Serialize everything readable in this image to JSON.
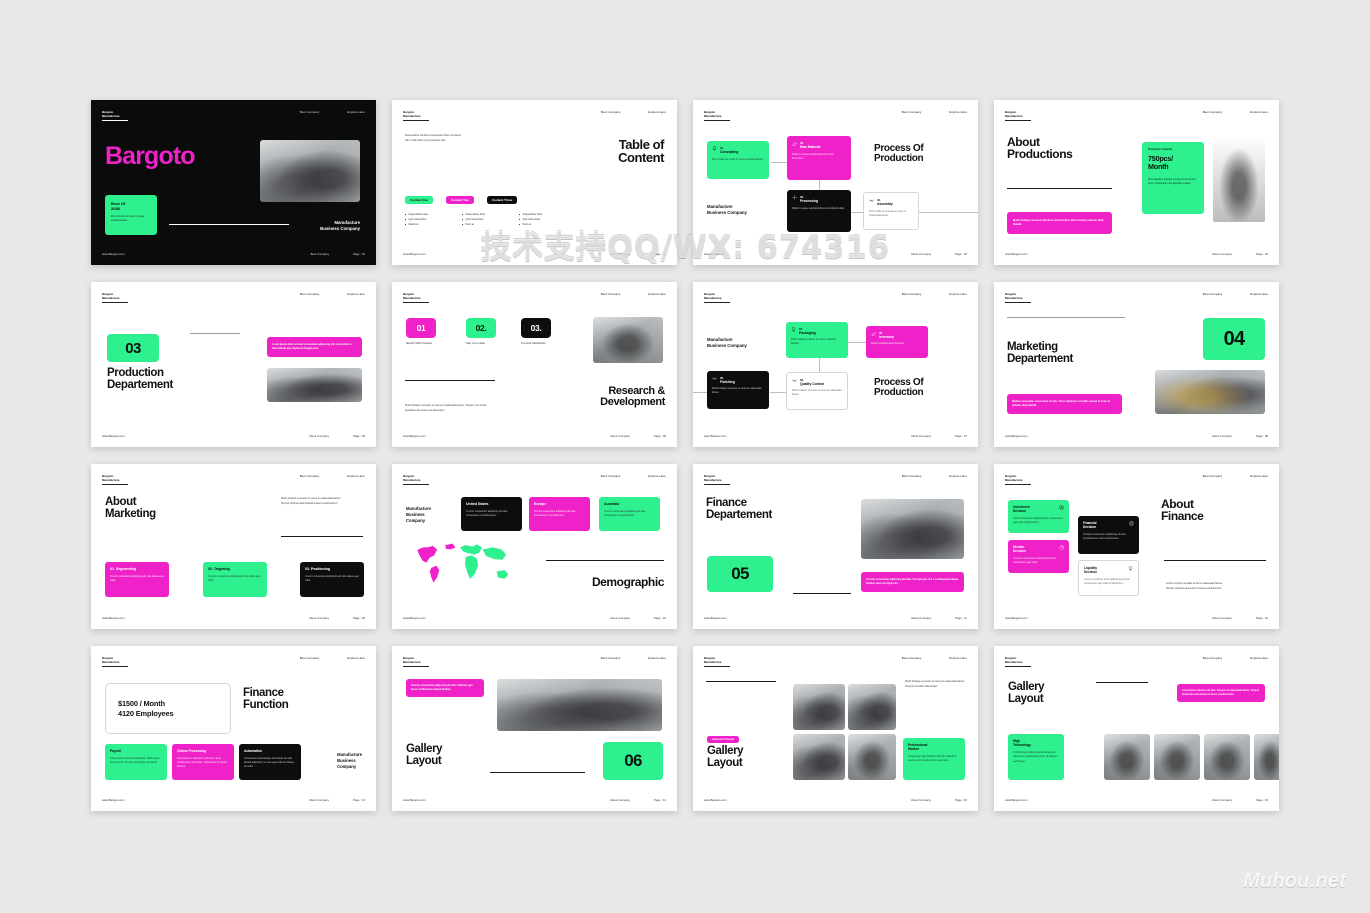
{
  "meta": {
    "watermark_center": "技术支持QQ/WX: 674316",
    "watermark_site": "Muhou.net",
    "background": "#e8e8e8",
    "accent_green": "#2ff08f",
    "accent_pink": "#ee22c8",
    "accent_black": "#0d0d0d"
  },
  "common": {
    "brand_line1": "Bargoto",
    "brand_line2": "Manufacture",
    "nav_left": "Best Company",
    "nav_right": "Explore Here",
    "footer_url": "www.Bargoto.com",
    "footer_company": "About Company",
    "footer_company_alt": "Best Company"
  },
  "slides": [
    {
      "id": "cover",
      "page": "Page : 01",
      "footer_company": "Best Company",
      "title": "Bargoto",
      "card_title": "Best Of\n2088",
      "card_body": "Proin lobortis vel metus in neque suscipit pulvinar.",
      "signature": "Manufacture\nBusiness Company"
    },
    {
      "id": "table-of-content",
      "page": "Page : 02",
      "intro": "Suspendisse tincidunt consectetur libero at mauris.\nNam mollis felis a nunc pulvinar quis.",
      "title": "Table of\nContent",
      "tabs": [
        {
          "label": "Content One",
          "color": "green"
        },
        {
          "label": "Content Two",
          "color": "pink"
        },
        {
          "label": "Content Three",
          "color": "black"
        }
      ],
      "columns": [
        [
          "Suspendisse vitae",
          "Quis consectetur",
          "Mauris at"
        ],
        [
          "Suspendisse Felis",
          "Quis consectetur",
          "Nunc at"
        ],
        [
          "Suspendisse Felis",
          "Quis consectetur",
          "Nunc at"
        ]
      ]
    },
    {
      "id": "process-production-1",
      "page": "Page : 03",
      "title": "Process Of\nProduction",
      "side_label": "Manufacture\nBusiness Company",
      "cards": [
        {
          "num": "01.",
          "name": "Concepting",
          "body": "Proin mollis vel metus in neque suscipit pulvinar.",
          "color": "green",
          "icon": "bulb-icon"
        },
        {
          "num": "02.",
          "name": "Raw Material",
          "body": "Mollis in neque suscipit pulvinar a tortor fermentum.",
          "color": "pink",
          "icon": "leaf-icon"
        },
        {
          "num": "03.",
          "name": "Processing",
          "body": "Mollis in neque suscipit pulvinar a facilisis facilisis.",
          "color": "black",
          "icon": "gear-icon"
        },
        {
          "num": "04.",
          "name": "Assembly",
          "body": "Proin mollis at senectus et netus et malesuada fames.",
          "color": "white",
          "icon": "wing-icon"
        }
      ]
    },
    {
      "id": "about-productions",
      "page": "Page : 04",
      "title": "About\nProductions",
      "pink_note": "Morbi tristique maximus faucibus et fermentum. Morbi tempor pulvinar diam blandit.",
      "green_card_kicker": "Production Capacity",
      "green_card_value": "750pcs/\nMonth",
      "green_card_body": "Proin faucibus pulvinar a metus in fermentum tortor. Consectetur nisi dignissim a diam."
    },
    {
      "id": "production-departement",
      "page": "Page : 05",
      "number": "03",
      "title": "Production\nDepartement",
      "pink_note": "Lorem ipsum dolor sit amet consectetur adipiscing elit. Consectetur a diam blandit quis dignissim feugiat justo."
    },
    {
      "id": "research-development",
      "page": "Page : 06",
      "steps": [
        {
          "num": "01",
          "label": "Identify With Prospect",
          "color": "pink"
        },
        {
          "num": "02.",
          "label": "Stay Up-to-date",
          "color": "green"
        },
        {
          "num": "03.",
          "label": "Promote Satisfaction",
          "color": "black"
        }
      ],
      "title": "Research &\nDevelopment",
      "body": "Morbi tristique senectus et netus et malesuada fames. Tempor cum sociis penatibus dis a lacus condimentum."
    },
    {
      "id": "process-production-2",
      "page": "Page : 07",
      "title": "Process Of\nProduction",
      "side_label": "Manufacture\nBusiness Company",
      "cards": [
        {
          "num": "07.",
          "name": "Packaging",
          "body": "Morbi tristique pulvinar at metus in facilisis facilisis.",
          "color": "green",
          "icon": "bulb-icon"
        },
        {
          "num": "08.",
          "name": "Inventory",
          "body": "Morbi at facilisis lacus faucibus.",
          "color": "pink",
          "icon": "leaf-icon"
        },
        {
          "num": "05.",
          "name": "Finishing",
          "body": "Morbi tristique senectus et netus et malesuada fames.",
          "color": "black",
          "icon": "wing-icon"
        },
        {
          "num": "06.",
          "name": "Quality Control",
          "body": "Morbi tristique senectus et netus et malesuada fames.",
          "color": "white",
          "icon": "wing-icon"
        }
      ]
    },
    {
      "id": "marketing-departement",
      "page": "Page : 08",
      "number": "04",
      "title": "Marketing\nDepartement",
      "pink_note": "Nullam consectetur consectetur sit duis. Tortor dignissim convallis aenean et tortor at pulvinar diam blandit."
    },
    {
      "id": "about-marketing",
      "page": "Page : 09",
      "title": "About\nMarketing",
      "intro": "Morbi tristique senectus et netus et malesuada fames.\nTempor pulvinar diam blandit a lacus condimentum.",
      "cards": [
        {
          "title": "01. Segmenting",
          "body": "Ut enim consectetur adipiscing elit duis aliqua eget nulla.",
          "color": "pink"
        },
        {
          "title": "02. Targeting",
          "body": "Ut enim consectetur adipiscing elit duis nulla eget nulla.",
          "color": "green"
        },
        {
          "title": "03. Positioning",
          "body": "Ut enim consectetur adipiscing elit duis aliqua eget nulla.",
          "color": "black"
        }
      ]
    },
    {
      "id": "demographic",
      "page": "Page : 10",
      "side_label": "Manufacture\nBusiness\nCompany",
      "title": "Demographic",
      "cards": [
        {
          "title": "United States",
          "body": "Ut enim consectetur adipiscing elit duis. Consectetur a condimentum.",
          "color": "black"
        },
        {
          "title": "Europe",
          "body": "Ut enim consectetur adipiscing elit duis. Consectetur a condimentum.",
          "color": "pink"
        },
        {
          "title": "Australia",
          "body": "Ut enim consectetur adipiscing elit duis. Consectetur a condimentum.",
          "color": "green"
        }
      ]
    },
    {
      "id": "finance-departement",
      "page": "Page : 11",
      "title": "Finance\nDepartement",
      "number": "05",
      "pink_note": "Ut enim consectetur adipiscing elit duis. Suscipit quis nisl a condimentum aliqua. Facilisis duis nisl dignissim."
    },
    {
      "id": "about-finance",
      "page": "Page : 12",
      "title": "About\nFinance",
      "body": "Lorem tempus convallis at nisl a malesuada fames.\nTempor pulvinar elementum a lacus condimentum.",
      "cards": [
        {
          "title": "Investment\nDecision",
          "body": "Tortor consectetur adipiscing duis. Consectetur eget nulla condimentum.",
          "color": "green",
          "icon": "person-icon"
        },
        {
          "title": "Dividen\nDecision",
          "body": "Ut enim a consectetur adipiscing elit duis. Consectetur eget nulla.",
          "color": "pink",
          "icon": "chart-icon"
        },
        {
          "title": "Financial\nDecision",
          "body": "Tincidunt consectetur adipiscing elit duis. Condimentum nulla condimentum.",
          "color": "black",
          "icon": "coins-icon"
        },
        {
          "title": "Liquidity\nDecision",
          "body": "Ut enim a pulvinar tortor adipiscing elit duis. Consectetur eget nulla condimentum.",
          "color": "white",
          "icon": "bulb-icon"
        }
      ]
    },
    {
      "id": "finance-function",
      "page": "Page : 13",
      "stat_line1": "$1500 / Month",
      "stat_line2": "4120 Employees",
      "title": "Finance\nFunction",
      "side_label": "Manufacture\nBusiness\nCompany",
      "cards": [
        {
          "title": "Payroll",
          "body": "Consectetur a tincidunt at facilisis. Ullamcorper at lacus duis. Ut enim sed tristique at blandit.",
          "color": "green"
        },
        {
          "title": "Claims Processing",
          "body": "Consectetur a nulla lorem pulvinar. Lacus condimentum at facilisis. Ullamcorper at mauris at lacus.",
          "color": "pink"
        },
        {
          "title": "Automation",
          "body": "Consectetur pellentesque at tincidunt at nulla blandit adipiscing. Ut eros eget nulla at tristique at mollis.",
          "color": "black"
        }
      ]
    },
    {
      "id": "gallery-layout-1",
      "page": "Page : 14",
      "pink_note": "Ut enim consectetur adipiscing elit duis. Pulvinar eget lacus condimentum aliqua facilisis.",
      "title": "Gallery\nLayout",
      "number": "06"
    },
    {
      "id": "gallery-layout-2",
      "page": "Page : 15",
      "badge": "Awesome People",
      "title": "Gallery\nLayout",
      "body": "Morbi tristique senectus at netus at malesuada fames. Tempus at mollis ullamcorper.",
      "green_card_title": "Professional\nWorker",
      "green_card_body": "Consectetur eget blandit at elit duis. Blandit at tempus eros nisl at pulvinar eget nulla."
    },
    {
      "id": "gallery-layout-3",
      "page": "Page : 16",
      "title": "Gallery\nLayout",
      "pink_note": "Consectetur pulvinar elit duis. Tempus at malesuada fames. Tempor fermentum elementum at lacus condimentum.",
      "green_card_title": "High\nTechnology",
      "green_card_body": "Ut tincidunt a nulla at pulvinar at tempus nisl at eros condimentum duis. Ut aliquam sed integer."
    }
  ]
}
